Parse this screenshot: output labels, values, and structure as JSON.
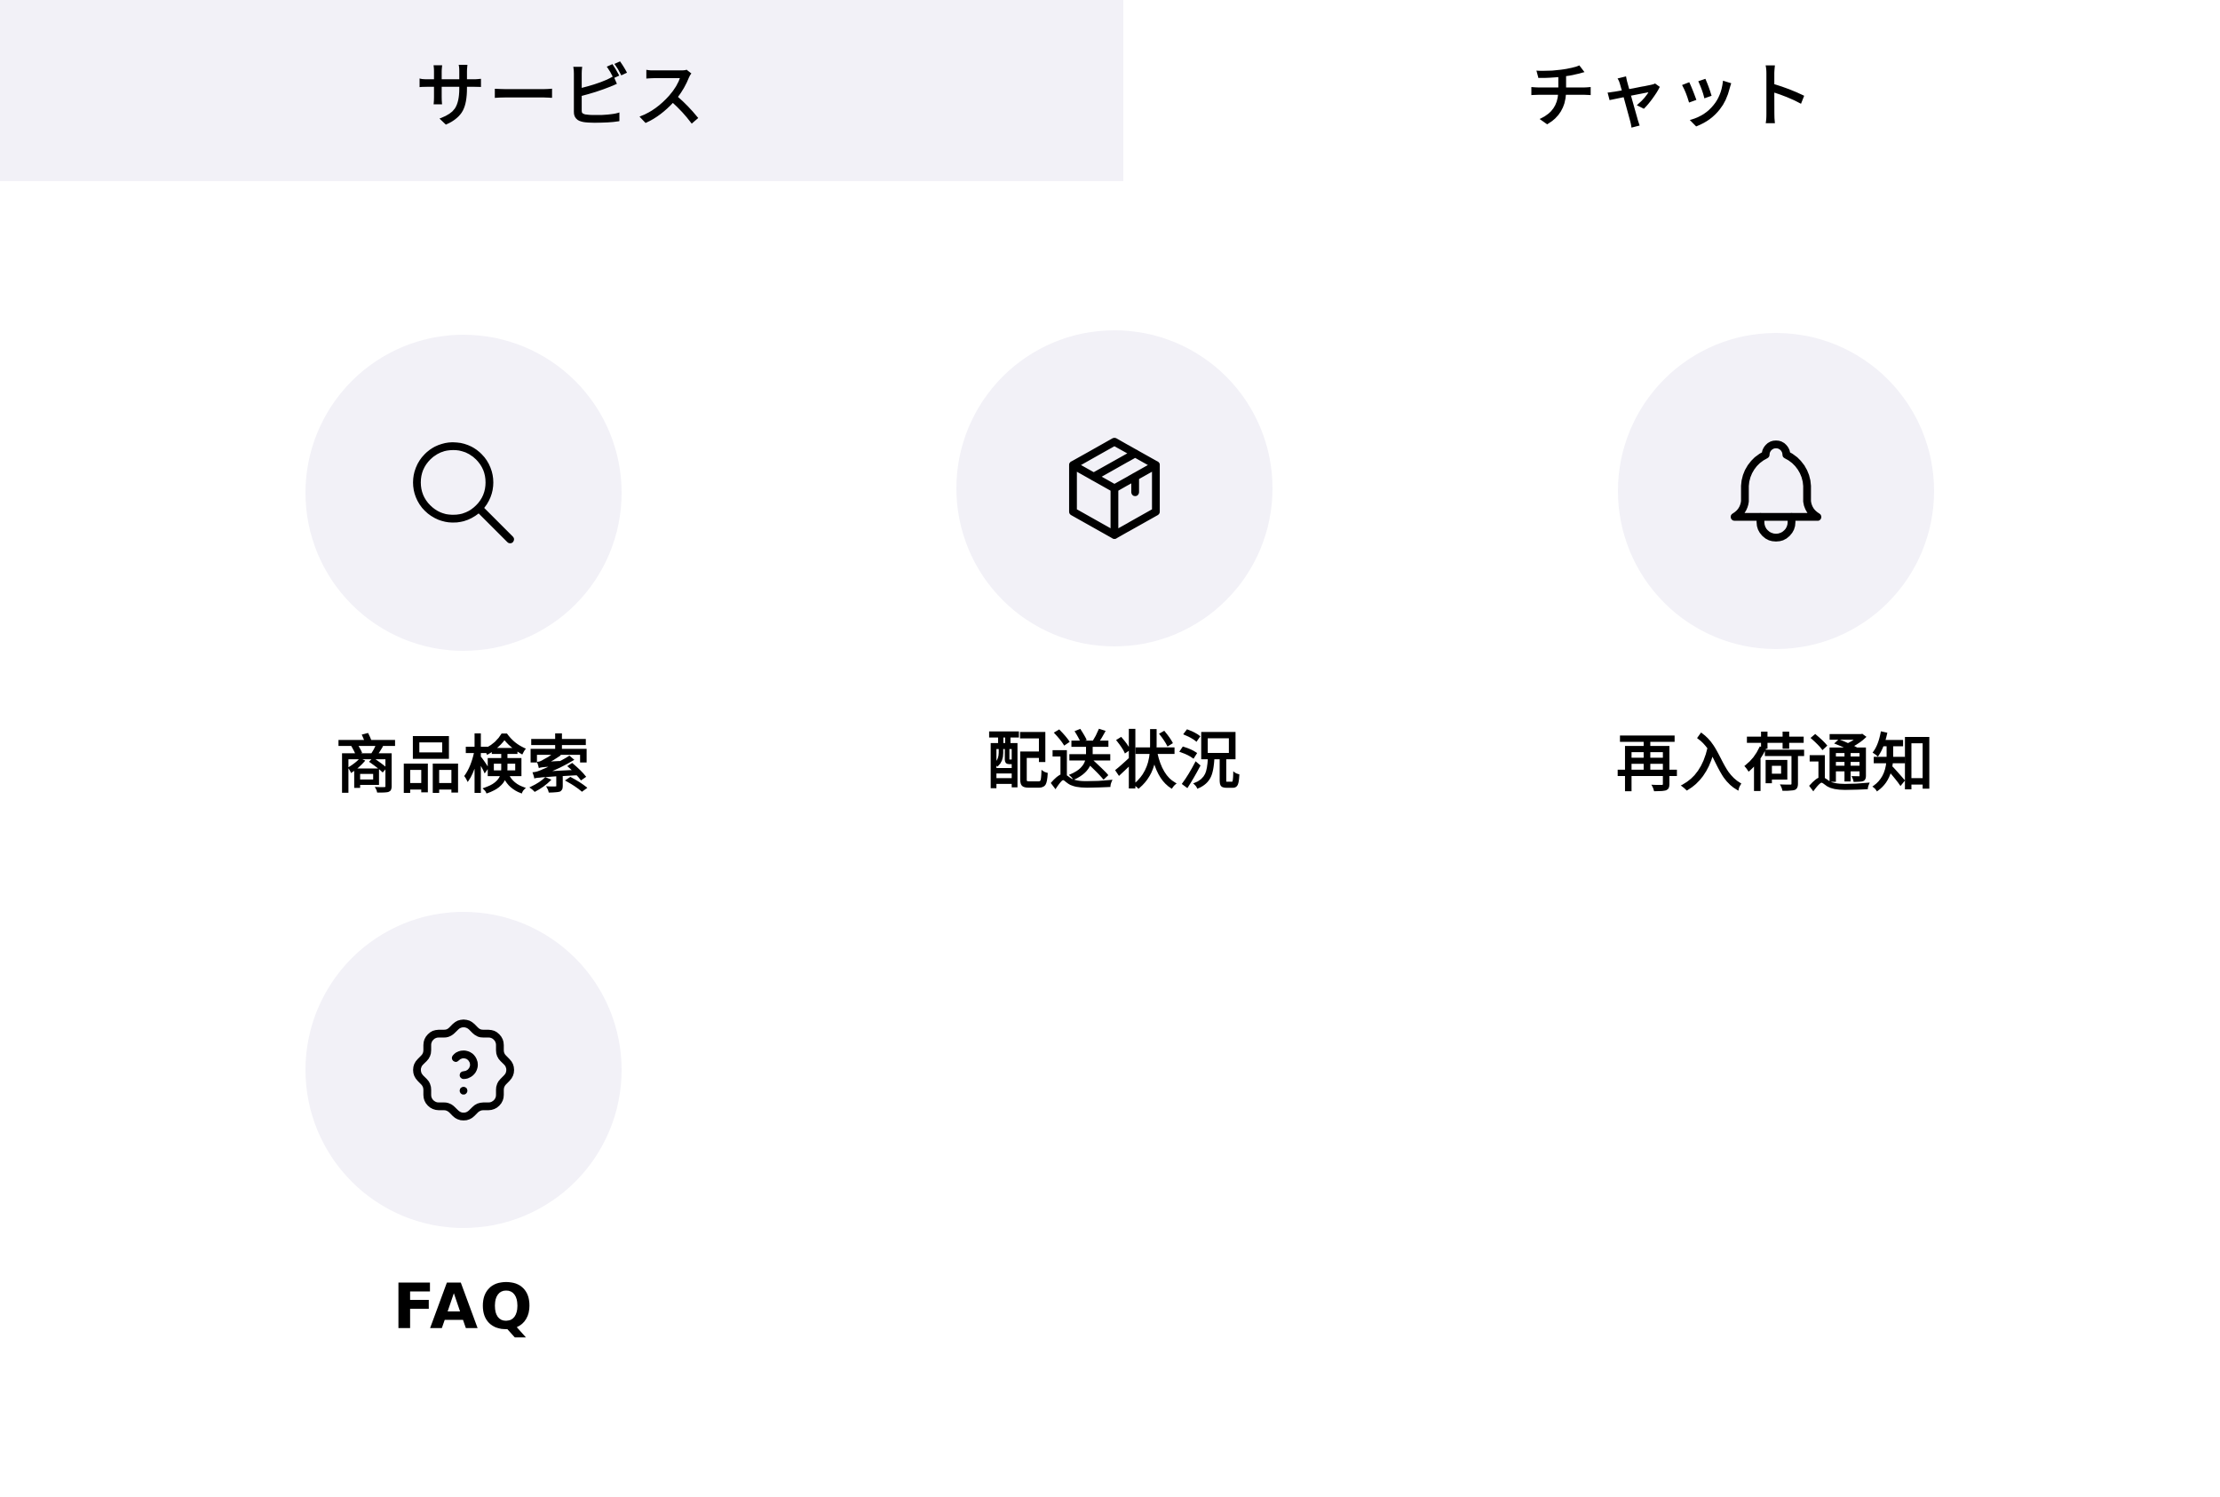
{
  "tabs": [
    {
      "label": "サービス",
      "selected": true
    },
    {
      "label": "チャット",
      "selected": false
    }
  ],
  "services": [
    {
      "label": "商品検索",
      "icon": "search-icon"
    },
    {
      "label": "配送状況",
      "icon": "package-icon"
    },
    {
      "label": "再入荷通知",
      "icon": "bell-icon"
    },
    {
      "label": "FAQ",
      "icon": "help-badge-icon"
    }
  ],
  "colors": {
    "active_tab_background": "#f2f1f7",
    "icon_circle_background": "#f2f1f7",
    "text": "#000000"
  }
}
